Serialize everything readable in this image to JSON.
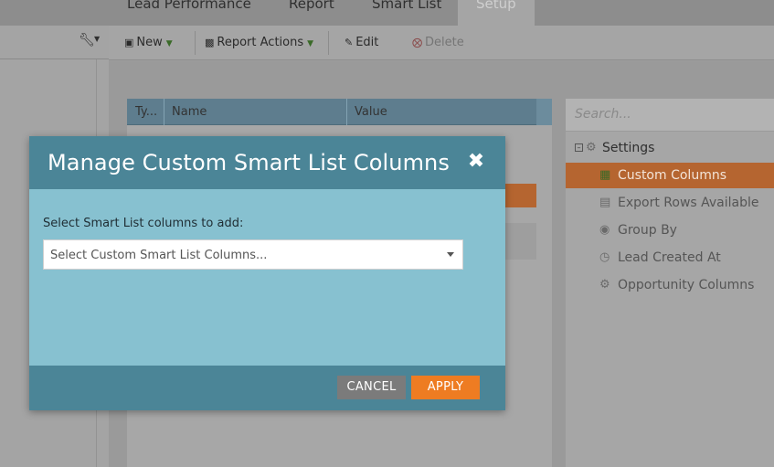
{
  "tabs": [
    "Lead Performance",
    "Report",
    "Smart List",
    "Setup"
  ],
  "toolbar": {
    "new_label": "New",
    "report_actions_label": "Report Actions",
    "edit_label": "Edit",
    "delete_label": "Delete"
  },
  "grid": {
    "columns": [
      "Ty...",
      "Name",
      "Value"
    ]
  },
  "right_panel": {
    "search_placeholder": "Search...",
    "root_label": "Settings",
    "items": [
      {
        "label": "Custom Columns",
        "icon": "grid-icon",
        "selected": true
      },
      {
        "label": "Export Rows Available",
        "icon": "export-icon",
        "selected": false
      },
      {
        "label": "Group By",
        "icon": "group-icon",
        "selected": false
      },
      {
        "label": "Lead Created At",
        "icon": "clock-icon",
        "selected": false
      },
      {
        "label": "Opportunity Columns",
        "icon": "gear-icon",
        "selected": false
      }
    ]
  },
  "modal": {
    "title": "Manage Custom Smart List Columns",
    "field_label": "Select Smart List columns to add:",
    "select_placeholder": "Select Custom Smart List Columns...",
    "cancel_label": "CANCEL",
    "apply_label": "APPLY"
  },
  "colors": {
    "modal_header": "#4b8597",
    "modal_body": "#87c1d0",
    "apply_button": "#ee7c22",
    "cancel_button": "#7b7b7b",
    "selected_item": "#b56530"
  }
}
